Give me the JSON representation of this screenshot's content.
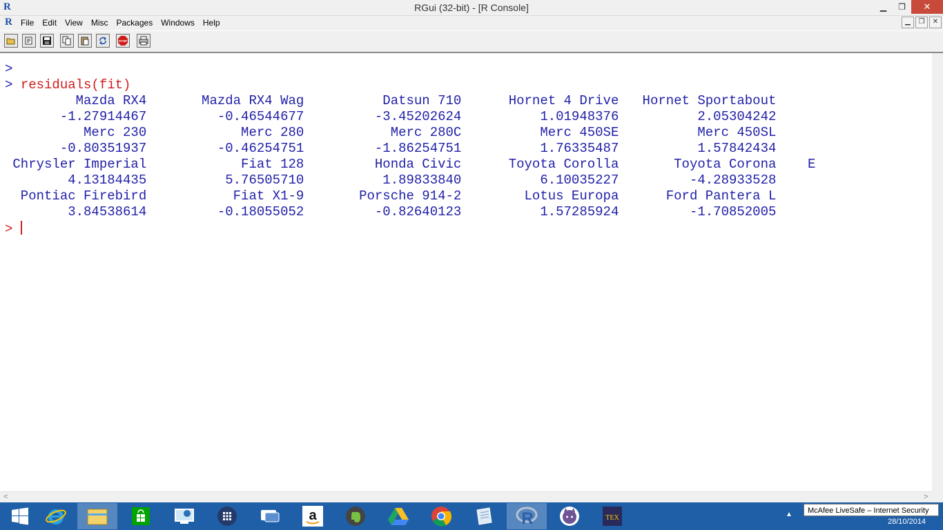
{
  "window": {
    "title": "RGui (32-bit) - [R Console]",
    "app_icon": "R",
    "minimize": "▁",
    "maximize": "❐",
    "close": "✕"
  },
  "menu": {
    "items": [
      "File",
      "Edit",
      "View",
      "Misc",
      "Packages",
      "Windows",
      "Help"
    ],
    "mdi_buttons": [
      "▁",
      "❐",
      "✕"
    ]
  },
  "toolbar": {
    "buttons": [
      "open-script-icon",
      "load-workspace-icon",
      "save-workspace-icon",
      "copy-icon",
      "paste-icon",
      "copy-paste-icon",
      "stop-icon",
      "print-icon"
    ],
    "stop_label": "STOP"
  },
  "console": {
    "prompt": ">",
    "command": "residuals(fit)",
    "output_lines": [
      "         Mazda RX4       Mazda RX4 Wag          Datsun 710      Hornet 4 Drive   Hornet Sportabout",
      "       -1.27914467         -0.46544677         -3.45202624          1.01948376          2.05304242",
      "          Merc 230            Merc 280           Merc 280C          Merc 450SE          Merc 450SL",
      "       -0.80351937         -0.46254751         -1.86254751          1.76335487          1.57842434",
      " Chrysler Imperial            Fiat 128         Honda Civic      Toyota Corolla       Toyota Corona    E",
      "        4.13184435          5.76505710          1.89833840          6.10035227         -4.28933528",
      "  Pontiac Firebird           Fiat X1-9       Porsche 914-2        Lotus Europa      Ford Pantera L",
      "        3.84538614         -0.18055052         -0.82640123          1.57285924         -1.70852005"
    ]
  },
  "scrollbar": {
    "left_arrow": "<",
    "right_arrow": ">"
  },
  "taskbar": {
    "apps": [
      "windows-start-icon",
      "internet-explorer-icon",
      "file-explorer-icon",
      "windows-store-icon",
      "remote-desktop-icon",
      "app-grid-icon",
      "chat-icon",
      "amazon-icon",
      "evernote-icon",
      "google-drive-icon",
      "chrome-icon",
      "notepad-icon",
      "r-icon",
      "github-cat-icon",
      "tex-icon"
    ],
    "amazon_glyph": "a",
    "r_glyph": "R",
    "tex_glyph": "TEX",
    "tooltip": "McAfee LiveSafe – Internet Security",
    "date": "28/10/2014",
    "tray_arrow": "▲"
  }
}
